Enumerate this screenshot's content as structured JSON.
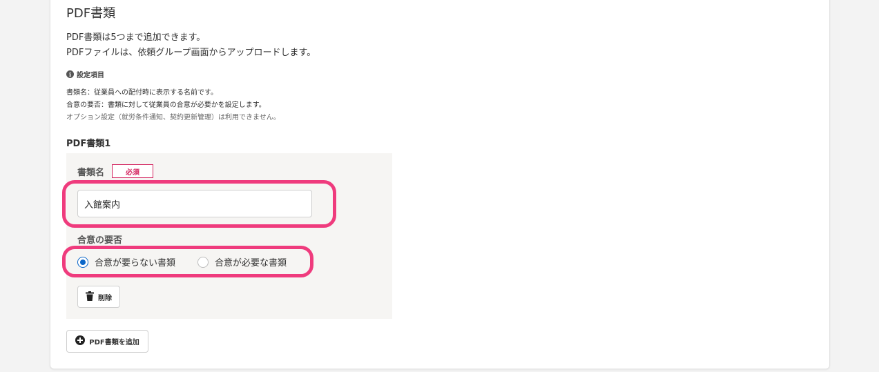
{
  "section": {
    "title": "PDF書類",
    "desc_line1": "PDF書類は5つまで追加できます。",
    "desc_line2": "PDFファイルは、依頼グループ画面からアップロードします。"
  },
  "info": {
    "heading": "設定項目",
    "line1": "書類名：従業員への配付時に表示する名前です。",
    "line2": "合意の要否：書類に対して従業員の合意が必要かを設定します。",
    "line3": "オプション設定（就労条件通知、契約更新管理）は利用できません。"
  },
  "doc": {
    "heading": "PDF書類1",
    "name_label": "書類名",
    "required_badge": "必須",
    "name_value": "入館案内",
    "consent_label": "合意の要否",
    "options": [
      {
        "label": "合意が要らない書類",
        "checked": true
      },
      {
        "label": "合意が必要な書類",
        "checked": false
      }
    ],
    "delete_label": "削除"
  },
  "add_button_label": "PDF書類を追加",
  "colors": {
    "highlight": "#ef3b7d",
    "required": "#d3235e",
    "radio_selected": "#0b67c9"
  }
}
